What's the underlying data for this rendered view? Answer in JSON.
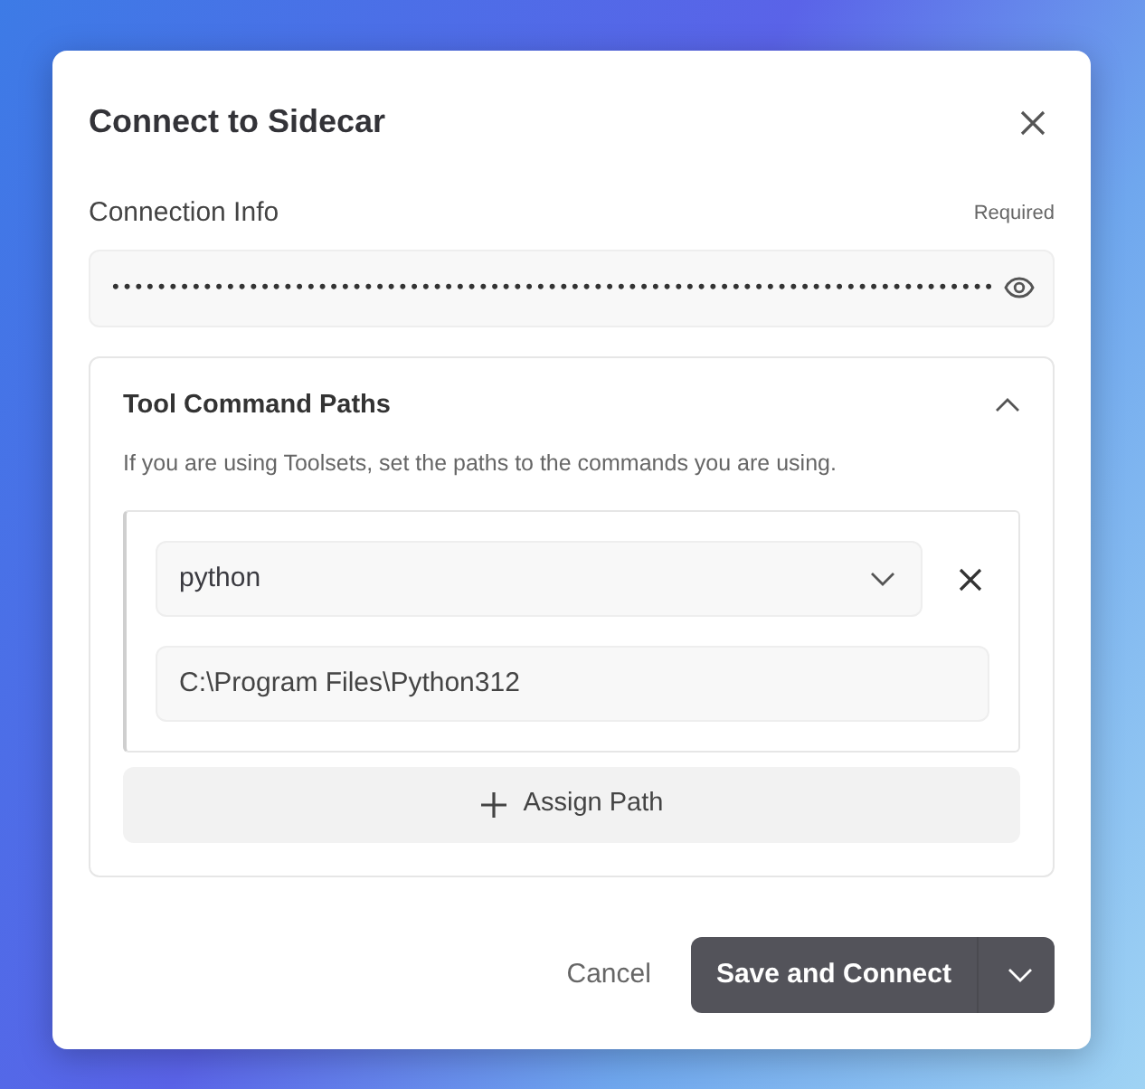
{
  "dialog": {
    "title": "Connect to Sidecar"
  },
  "connection_info": {
    "label": "Connection Info",
    "hint": "Required",
    "masked_value": "•••••••••••••••••••••••••••••••••••••••••••••••••••••••••••••••••••••••••••••"
  },
  "section": {
    "title": "Tool Command Paths",
    "expanded": true,
    "description": "If you are using Toolsets, set the paths to the commands you are using.",
    "entries": [
      {
        "command": "python",
        "path": "C:\\Program Files\\Python312"
      }
    ],
    "add_button": "Assign Path"
  },
  "footer": {
    "cancel": "Cancel",
    "primary": "Save and Connect"
  }
}
